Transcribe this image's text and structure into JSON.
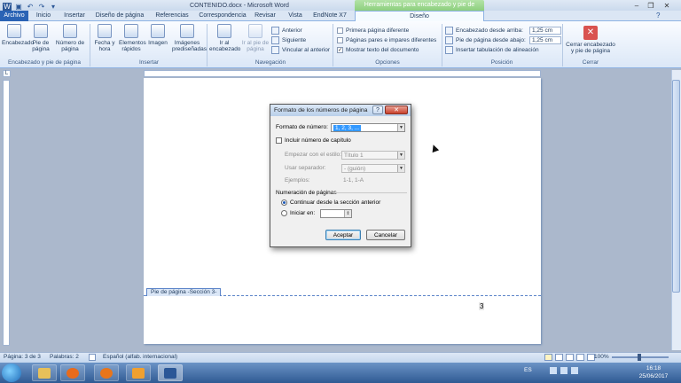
{
  "window": {
    "title": "CONTENIDO.docx - Microsoft Word",
    "context_tab": "Herramientas para encabezado y pie de página",
    "controls": {
      "minimize": "–",
      "maximize": "❐",
      "close": "✕"
    }
  },
  "tabs": [
    "Archivo",
    "Inicio",
    "Insertar",
    "Diseño de página",
    "Referencias",
    "Correspondencia",
    "Revisar",
    "Vista",
    "EndNote X7",
    "Diseño"
  ],
  "ribbon": {
    "group_header_footer": {
      "label": "Encabezado y pie de página",
      "buttons": [
        "Encabezado",
        "Pie de página",
        "Número de página"
      ]
    },
    "group_insert": {
      "label": "Insertar",
      "buttons": [
        "Fecha y hora",
        "Elementos rápidos",
        "Imagen",
        "Imágenes prediseñadas"
      ]
    },
    "group_nav": {
      "label": "Navegación",
      "buttons": [
        "Ir al encabezado",
        "Ir al pie de página"
      ],
      "small": [
        "Anterior",
        "Siguiente",
        "Vincular al anterior"
      ]
    },
    "group_options": {
      "label": "Opciones",
      "items": [
        "Primera página diferente",
        "Páginas pares e impares diferentes",
        "Mostrar texto del documento"
      ],
      "checked": [
        false,
        false,
        true
      ]
    },
    "group_position": {
      "label": "Posición",
      "rows": [
        "Encabezado desde arriba:",
        "Pie de página desde abajo:",
        "Insertar tabulación de alineación"
      ],
      "values": [
        "1,25 cm",
        "1,25 cm"
      ]
    },
    "group_close": {
      "label": "Cerrar",
      "button": "Cerrar encabezado y pie de página"
    }
  },
  "ruler": {
    "corner": "L"
  },
  "document": {
    "footer_tag": "Pie de página -Sección 3-",
    "page_number": "3"
  },
  "dialog": {
    "title": "Formato de los números de página",
    "help": "?",
    "close": "✕",
    "format_label": "Formato de número:",
    "format_value": "1, 2, 3, ...",
    "include_chapter_label": "Incluir número de capítulo",
    "start_style_label": "Empezar con el estilo:",
    "start_style_value": "Título 1",
    "separator_label": "Usar separador:",
    "separator_value": "-    (guión)",
    "examples_label": "Ejemplos:",
    "examples_value": "1-1, 1-A",
    "numbering_section": "Numeración de páginas",
    "continue_label": "Continuar desde la sección anterior",
    "start_at_label": "Iniciar en:",
    "start_at_value": "",
    "ok": "Aceptar",
    "cancel": "Cancelar"
  },
  "statusbar": {
    "page": "Página: 3 de 3",
    "words": "Palabras: 2",
    "language": "Español (alfab. internacional)",
    "zoom": "100%"
  },
  "taskbar": {
    "lang": "ES",
    "time": "16:18",
    "date": "25/06/2017"
  },
  "colors": {
    "file_tab": "#2a63b5",
    "context_tab": "#8dcf7e",
    "close_button": "#c9402b"
  }
}
